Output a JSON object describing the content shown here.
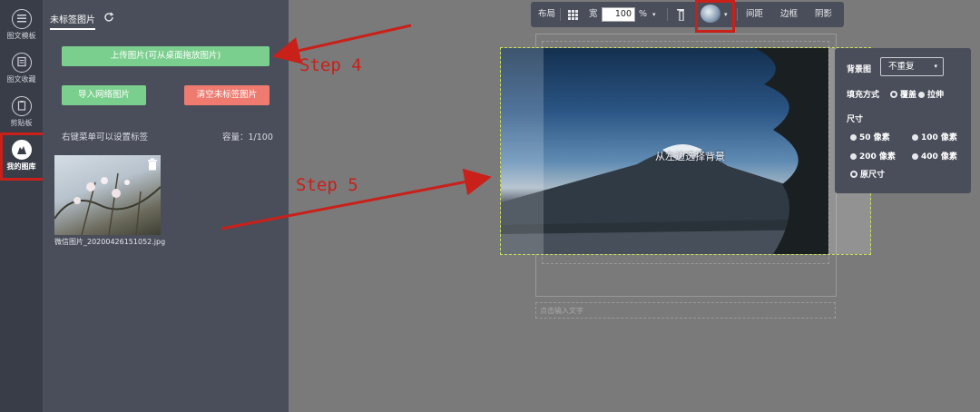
{
  "rail": {
    "items": [
      {
        "label": "图文模板",
        "icon": "menu-lines-icon"
      },
      {
        "label": "图文收藏",
        "icon": "collection-icon"
      },
      {
        "label": "剪贴板",
        "icon": "clipboard-icon"
      },
      {
        "label": "我的图库",
        "icon": "image-library-icon"
      }
    ]
  },
  "panel": {
    "tab_label": "未标签图片",
    "upload_button": "上传图片(可从桌面拖放图片)",
    "import_button": "导入网络图片",
    "clear_button": "清空未标签图片",
    "hint": "右键菜单可以设置标签",
    "capacity": "容量：1/100",
    "thumbnail_name": "微信图片_20200426151052.jpg"
  },
  "toolbar": {
    "layout": "布局",
    "width_label": "宽",
    "width_value": "100",
    "unit": "%",
    "spacing": "间距",
    "border": "边框",
    "shadow": "阴影"
  },
  "canvas": {
    "photo_caption": "从左边选择背景",
    "text_placeholder": "点击输入文字"
  },
  "popup": {
    "bg_label": "背景图",
    "bg_select": "不重复",
    "fill_label": "填充方式",
    "fill_cover": "覆盖",
    "fill_stretch": "拉伸",
    "size_label": "尺寸",
    "sizes": [
      "50 像素",
      "100 像素",
      "200 像素",
      "400 像素",
      "原尺寸"
    ]
  },
  "annotations": {
    "step4": "Step 4",
    "step5": "Step 5"
  },
  "colors": {
    "accent_green": "#7bcf8e",
    "accent_red": "#ef7b70",
    "annotation_red": "#c9201a",
    "panel_bg": "#4a4e5a"
  }
}
